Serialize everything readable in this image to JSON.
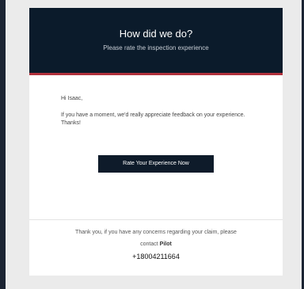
{
  "header": {
    "title": "How did we do?",
    "subtitle": "Please rate the inspection experience"
  },
  "body": {
    "greeting": "Hi Isaac,",
    "message": "If you have a moment, we'd really appreciate feedback on your experience. Thanks!",
    "cta_label": "Rate Your Experience Now"
  },
  "footer": {
    "line1": "Thank you, if you have any concerns regarding your claim, please",
    "contact_prefix": "contact",
    "contact_name": "Pilot",
    "phone": "+18004211664"
  },
  "colors": {
    "header_bg": "#0b1b2b",
    "accent_red": "#b0313c",
    "button_bg": "#0e1b2a",
    "page_bg": "#ebebeb"
  }
}
